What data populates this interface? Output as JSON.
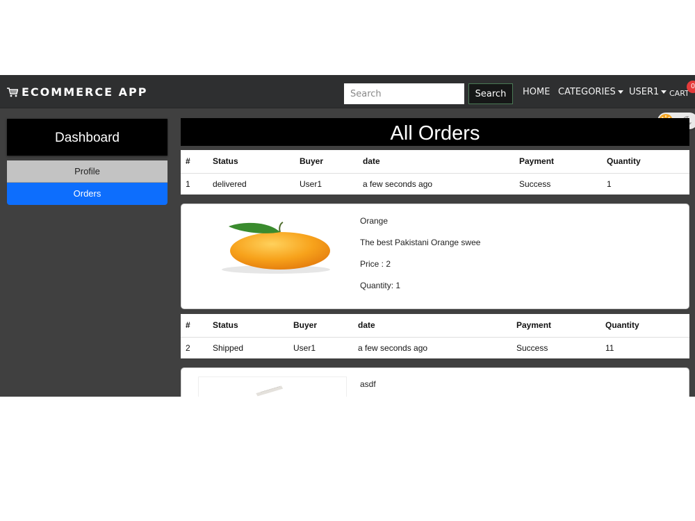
{
  "navbar": {
    "brand": "ECOMMERCE APP",
    "search_placeholder": "Search",
    "search_button": "Search",
    "home": "HOME",
    "categories": "CATEGORIES",
    "user": "USER1",
    "cart": "CART",
    "cart_count": "0"
  },
  "sidebar": {
    "title": "Dashboard",
    "items": [
      {
        "label": "Profile"
      },
      {
        "label": "Orders"
      }
    ]
  },
  "main": {
    "title": "All Orders",
    "columns": [
      "#",
      "Status",
      "Buyer",
      "date",
      "Payment",
      "Quantity"
    ],
    "orders": [
      {
        "row": [
          "1",
          "delivered",
          "User1",
          "a few seconds ago",
          "Success",
          "1"
        ],
        "product": {
          "name": "Orange",
          "description": "The best Pakistani Orange swee",
          "price": "Price : 2",
          "quantity": "Quantity: 1"
        }
      },
      {
        "row": [
          "2",
          "Shipped",
          "User1",
          "a few seconds ago",
          "Success",
          "11"
        ],
        "product": {
          "name": "asdf"
        }
      }
    ]
  },
  "colors": {
    "navbar_bg": "#2e2f30",
    "page_bg": "#404040",
    "active_menu": "#0d6efd",
    "badge": "#e63b3b"
  }
}
